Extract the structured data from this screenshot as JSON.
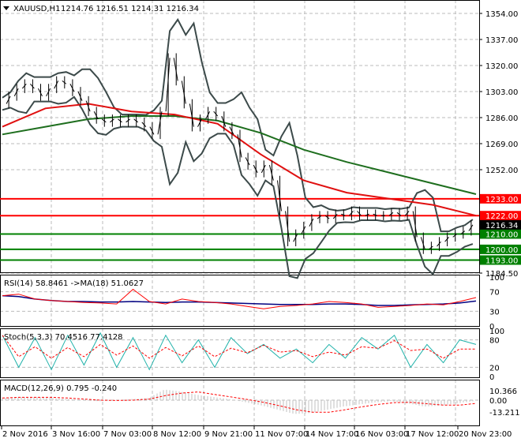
{
  "header": {
    "symbol": "XAUUSD,H1",
    "ohlc": "1214.76 1216.51 1214.31 1216.34"
  },
  "price_axis": [
    "1354.00",
    "1337.00",
    "1320.00",
    "1303.00",
    "1286.00",
    "1269.00",
    "1252.00",
    "1184.50"
  ],
  "levels": [
    {
      "label": "1233.00",
      "value": 1233,
      "color": "#ff0000"
    },
    {
      "label": "1222.00",
      "value": 1222,
      "color": "#ff0000"
    },
    {
      "label": "1210.00",
      "value": 1210,
      "color": "#008000"
    },
    {
      "label": "1200.00",
      "value": 1200,
      "color": "#008000"
    },
    {
      "label": "1193.00",
      "value": 1193,
      "color": "#008000"
    }
  ],
  "current_price": {
    "label": "1216.34",
    "value": 1216.34
  },
  "time_axis": [
    "2 Nov 2016",
    "3 Nov 16:00",
    "7 Nov 03:00",
    "8 Nov 12:00",
    "9 Nov 21:00",
    "11 Nov 07:00",
    "14 Nov 17:00",
    "16 Nov 03:00",
    "17 Nov 12:00",
    "20 Nov 23:00"
  ],
  "rsi": {
    "title": "RSI(14) 58.8461  ->MA(18) 51.0627",
    "axis": [
      "100",
      "70",
      "30",
      "0"
    ]
  },
  "stoch": {
    "title": "Stoch(5,3,3) 70.4516 77.4128",
    "axis": [
      "100",
      "80",
      "20",
      "0"
    ]
  },
  "macd": {
    "title": "MACD(12,26,9) 0.795 -0.240",
    "axis": [
      "10.366",
      "0.00",
      "-13.211"
    ]
  },
  "chart_data": {
    "type": "line",
    "close": [
      1295,
      1300,
      1305,
      1308,
      1305,
      1300,
      1305,
      1310,
      1308,
      1303,
      1297,
      1290,
      1285,
      1283,
      1285,
      1283,
      1285,
      1283,
      1280,
      1275,
      1290,
      1325,
      1310,
      1295,
      1280,
      1285,
      1290,
      1287,
      1280,
      1275,
      1260,
      1255,
      1250,
      1255,
      1245,
      1225,
      1205,
      1210,
      1215,
      1220,
      1222,
      1220,
      1223,
      1222,
      1225,
      1222,
      1223,
      1222,
      1222,
      1224,
      1222,
      1225,
      1208,
      1200,
      1202,
      1205,
      1208,
      1210,
      1212,
      1216
    ],
    "ma_red": [
      1280,
      1292,
      1295,
      1290,
      1288,
      1282,
      1262,
      1245,
      1237,
      1233,
      1229,
      1222
    ],
    "ma_green": [
      1275,
      1280,
      1285,
      1287,
      1287,
      1284,
      1276,
      1265,
      1257,
      1250,
      1243,
      1236
    ],
    "rsi": [
      62,
      65,
      55,
      52,
      50,
      48,
      47,
      45,
      75,
      50,
      45,
      55,
      50,
      48,
      45,
      40,
      35,
      40,
      42,
      45,
      50,
      48,
      45,
      38,
      40,
      42,
      45,
      43,
      50,
      58
    ],
    "rsi_ma": [
      62,
      60,
      55,
      52,
      50,
      50,
      49,
      49,
      50,
      49,
      48,
      49,
      49,
      48,
      47,
      46,
      45,
      44,
      44,
      44,
      45,
      45,
      44,
      42,
      42,
      43,
      44,
      45,
      47,
      51
    ],
    "stoch": [
      90,
      20,
      85,
      15,
      90,
      25,
      95,
      20,
      85,
      15,
      90,
      30,
      80,
      20,
      85,
      50,
      70,
      40,
      60,
      30,
      70,
      40,
      85,
      60,
      90,
      20,
      70,
      30,
      80,
      70
    ],
    "macd": [
      2,
      3,
      3,
      2,
      1,
      0,
      -1,
      0,
      1,
      2,
      10,
      8,
      5,
      3,
      1,
      -2,
      -5,
      -9,
      -13,
      -12,
      -9,
      -6,
      -4,
      -2,
      -1,
      -3,
      -6,
      -5,
      -3,
      -1
    ],
    "ylim": [
      1184.5,
      1354
    ]
  }
}
